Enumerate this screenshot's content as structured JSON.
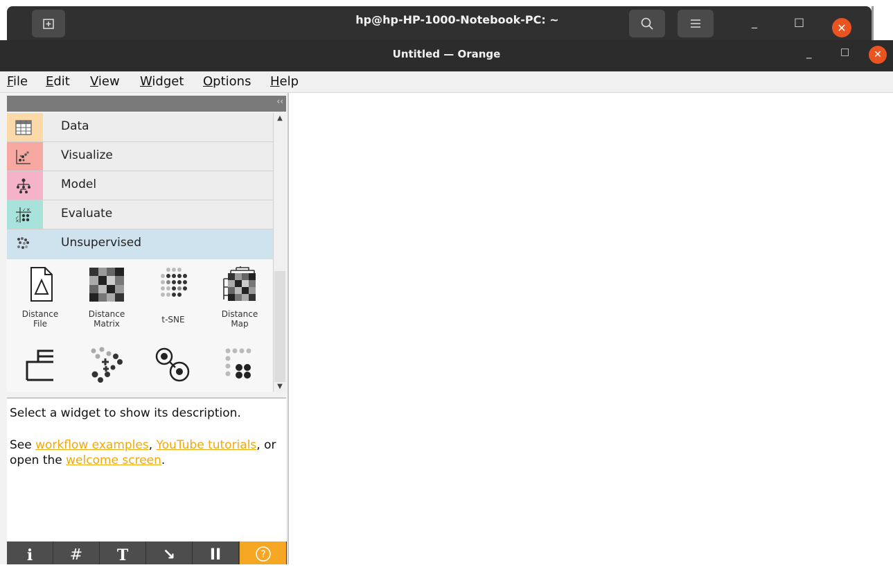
{
  "terminal": {
    "title": "hp@hp-HP-1000-Notebook-PC: ~",
    "new_tab_icon": "new-tab-icon",
    "search_icon": "search-icon",
    "menu_icon": "hamburger-icon",
    "min": "_",
    "max": "□",
    "close": "✕"
  },
  "window": {
    "title": "Untitled — Orange",
    "min": "_",
    "max": "□",
    "close": "✕"
  },
  "menu": [
    {
      "pre": "",
      "u": "F",
      "post": "ile"
    },
    {
      "pre": "",
      "u": "E",
      "post": "dit"
    },
    {
      "pre": "",
      "u": "V",
      "post": "iew"
    },
    {
      "pre": "",
      "u": "W",
      "post": "idget"
    },
    {
      "pre": "",
      "u": "O",
      "post": "ptions"
    },
    {
      "pre": "",
      "u": "H",
      "post": "elp"
    }
  ],
  "dock": {
    "collapse": "‹‹",
    "categories": [
      {
        "label": "Data",
        "color": "#fcd9a8",
        "icon": "table-icon"
      },
      {
        "label": "Visualize",
        "color": "#f7a8a0",
        "icon": "scatter-icon"
      },
      {
        "label": "Model",
        "color": "#f4b3c8",
        "icon": "tree-icon"
      },
      {
        "label": "Evaluate",
        "color": "#a7e3db",
        "icon": "evaluate-icon"
      },
      {
        "label": "Unsupervised",
        "color": "#d8d8d8",
        "icon": "clusters-icon"
      }
    ],
    "widgets": [
      {
        "label1": "Distance",
        "label2": "File"
      },
      {
        "label1": "Distance",
        "label2": "Matrix"
      },
      {
        "label1": "t-SNE",
        "label2": ""
      },
      {
        "label1": "Distance",
        "label2": "Map"
      }
    ],
    "scroll_up": "▲",
    "scroll_down": "▼"
  },
  "description": {
    "line1": "Select a widget to show its description.",
    "see": "See ",
    "link1": "workflow examples",
    "comma": ", ",
    "link2": "YouTube tutorials",
    "middle": ", or open the ",
    "link3": "welcome screen",
    "end": "."
  },
  "toolbar": {
    "info": "i",
    "grid": "#",
    "text": "T",
    "arrow": "↘",
    "pause": "II",
    "help": "?"
  }
}
